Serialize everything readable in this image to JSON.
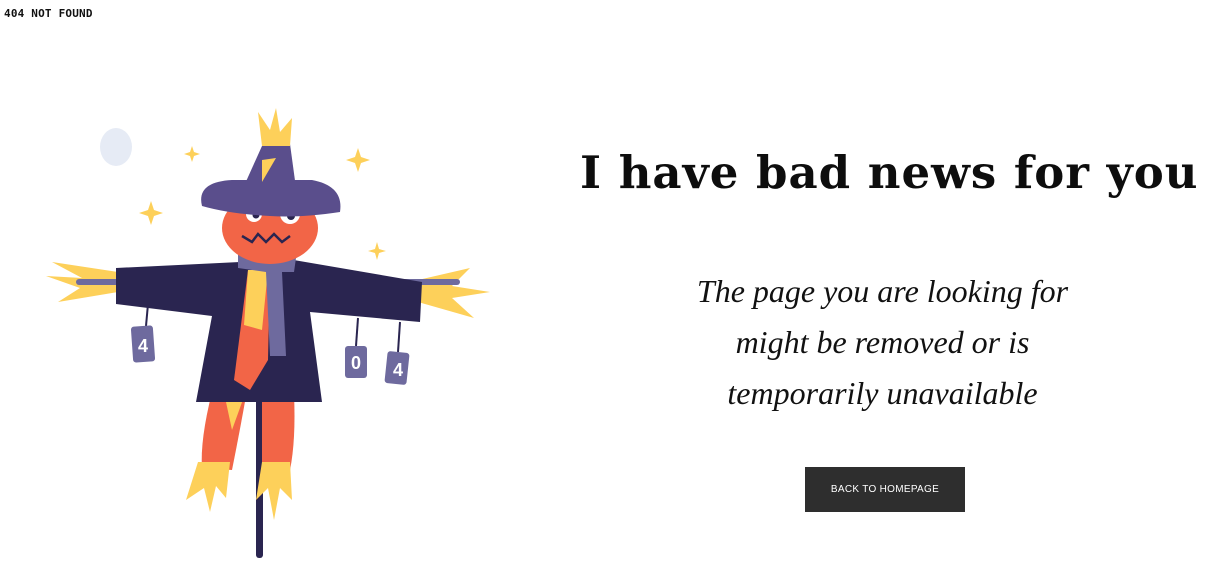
{
  "header": {
    "brand": "404 NOT FOUND"
  },
  "illustration": {
    "tags": [
      "4",
      "0",
      "4"
    ]
  },
  "content": {
    "headline": "I have bad news for you",
    "message": "The page you are looking for might be removed or is temporarily unavailable",
    "button_label": "BACK TO HOMEPAGE"
  },
  "colors": {
    "hat": "#5a4e8c",
    "coat": "#2a2550",
    "face": "#f26547",
    "straw": "#fdd05a",
    "scarf": "#6e6a9e",
    "button_bg": "#2e2e2e"
  }
}
